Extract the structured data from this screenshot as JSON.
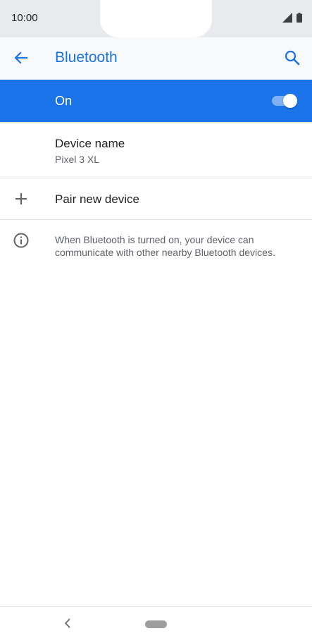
{
  "status_bar": {
    "time": "10:00",
    "icons": [
      "signal-icon",
      "battery-icon"
    ]
  },
  "app_bar": {
    "title": "Bluetooth",
    "back_icon": "arrow-back-icon",
    "search_icon": "search-icon",
    "accent_color": "#1a73e8"
  },
  "master_switch": {
    "label": "On",
    "state": "on",
    "background_color": "#1a73e8"
  },
  "settings": {
    "device_name": {
      "title": "Device name",
      "value": "Pixel 3 XL"
    },
    "pair_new_device": {
      "title": "Pair new device",
      "icon": "plus-icon"
    },
    "info": {
      "icon": "info-icon",
      "text": "When Bluetooth is turned on, your device can communicate with other nearby Bluetooth devices."
    }
  },
  "nav_bar": {
    "back_icon": "nav-back-icon",
    "home_icon": "home-pill-icon"
  }
}
